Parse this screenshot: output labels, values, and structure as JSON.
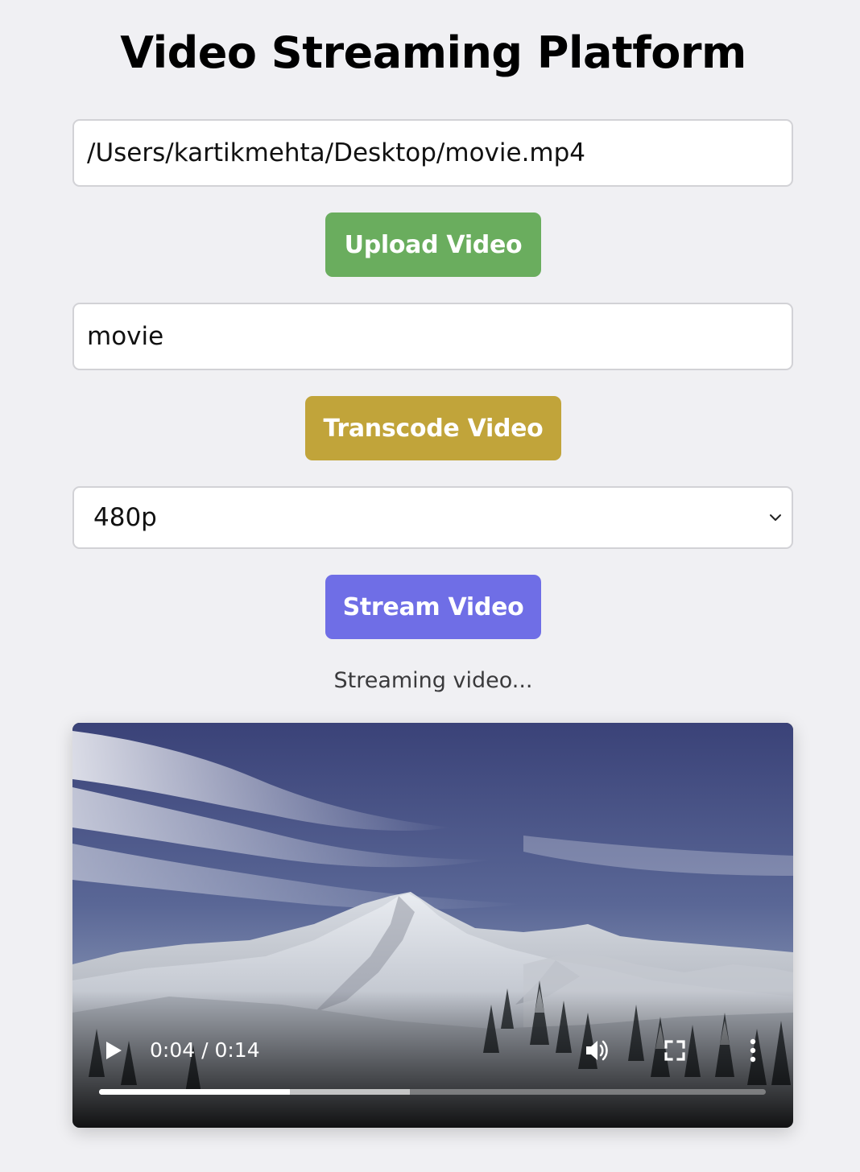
{
  "page": {
    "title": "Video Streaming Platform"
  },
  "upload": {
    "path_value": "/Users/kartikmehta/Desktop/movie.mp4",
    "button_label": "Upload Video"
  },
  "transcode": {
    "name_value": "movie",
    "button_label": "Transcode Video"
  },
  "stream": {
    "resolution_selected": "480p",
    "button_label": "Stream Video",
    "status_text": "Streaming video..."
  },
  "player": {
    "time_display": "0:04 / 0:14",
    "current_time_seconds": 4,
    "duration_seconds": 14,
    "buffered_fraction": 0.466,
    "icons": [
      "play-icon",
      "volume-icon",
      "fullscreen-icon",
      "more-options-icon"
    ]
  },
  "colors": {
    "background": "#f0f0f3",
    "upload_button": "#6aad5e",
    "transcode_button": "#c1a43a",
    "stream_button": "#6f6ee6"
  }
}
